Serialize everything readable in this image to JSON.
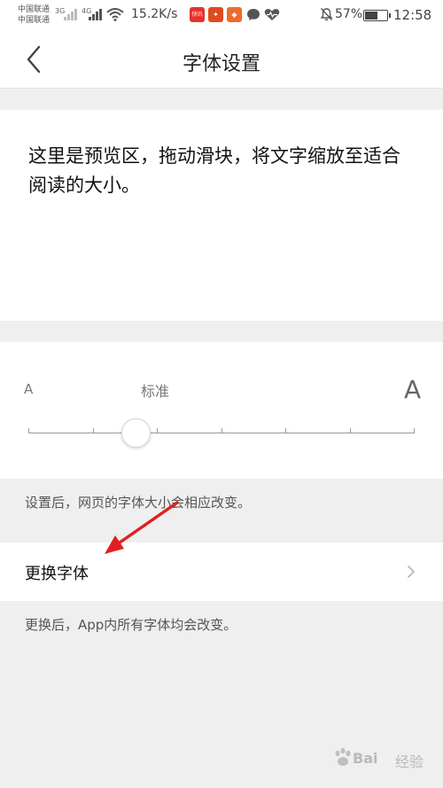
{
  "status_bar": {
    "carrier_1": "中国联通",
    "carrier_2": "中国联通",
    "network_1": "3G",
    "network_2": "4G",
    "net_speed": "15.2K/s",
    "battery_percent": "57%",
    "battery_level": 0.57,
    "time": "12:58",
    "app_badge_1": "快讯"
  },
  "header": {
    "title": "字体设置",
    "back_icon": "chevron-left-icon"
  },
  "preview": {
    "text": "这里是预览区，拖动滑块，将文字缩放至适合阅读的大小。"
  },
  "font_size": {
    "small_label": "A",
    "large_label": "A",
    "current_label": "标准",
    "steps": 7,
    "selected_step": 2
  },
  "notes": {
    "size_note": "设置后，网页的字体大小会相应改变。",
    "font_note": "更换后，App内所有字体均会改变。"
  },
  "change_font": {
    "label": "更换字体",
    "chevron_icon": "chevron-right-icon"
  },
  "watermark": {
    "brand": "Bai",
    "suffix": "经验"
  },
  "colors": {
    "background": "#efefef",
    "card": "#ffffff",
    "annotation_arrow": "#e02020"
  }
}
